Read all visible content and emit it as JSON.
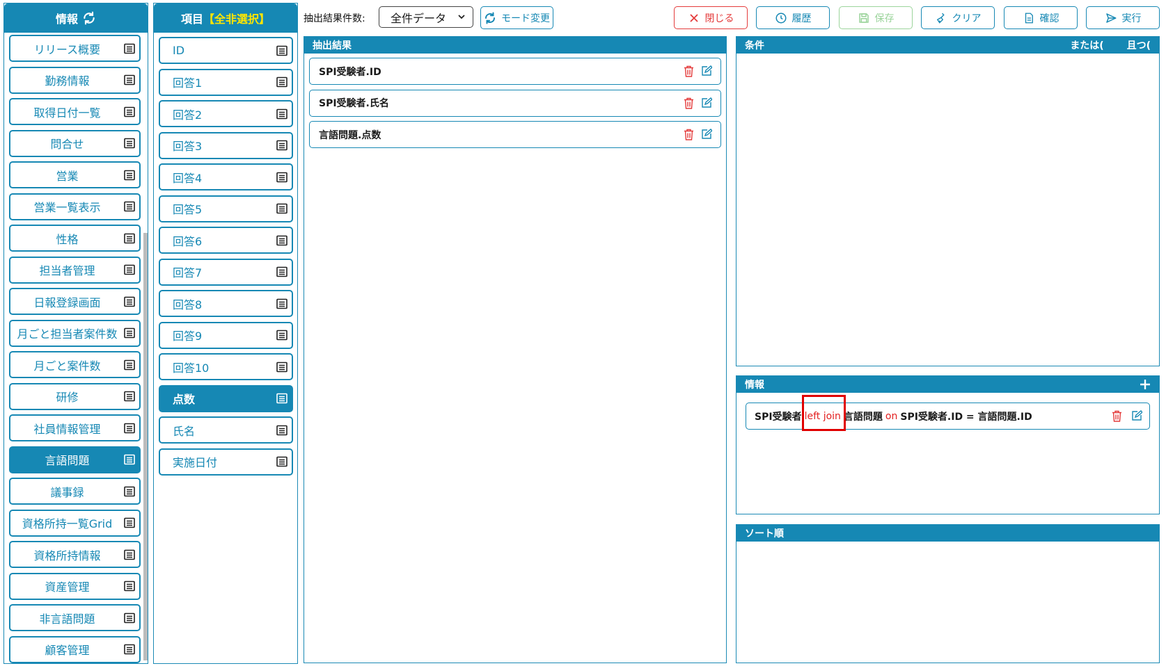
{
  "left": {
    "title": "情報",
    "items": [
      {
        "label": "リリース概要",
        "active": false
      },
      {
        "label": "勤務情報",
        "active": false
      },
      {
        "label": "取得日付一覧",
        "active": false
      },
      {
        "label": "問合せ",
        "active": false
      },
      {
        "label": "営業",
        "active": false
      },
      {
        "label": "営業一覧表示",
        "active": false
      },
      {
        "label": "性格",
        "active": false
      },
      {
        "label": "担当者管理",
        "active": false
      },
      {
        "label": "日報登録画面",
        "active": false
      },
      {
        "label": "月ごと担当者案件数",
        "active": false
      },
      {
        "label": "月ごと案件数",
        "active": false
      },
      {
        "label": "研修",
        "active": false
      },
      {
        "label": "社員情報管理",
        "active": false
      },
      {
        "label": "言語問題",
        "active": true
      },
      {
        "label": "議事録",
        "active": false
      },
      {
        "label": "資格所持一覧Grid",
        "active": false
      },
      {
        "label": "資格所持情報",
        "active": false
      },
      {
        "label": "資産管理",
        "active": false
      },
      {
        "label": "非言語問題",
        "active": false
      },
      {
        "label": "顧客管理",
        "active": false
      }
    ]
  },
  "fields": {
    "title_prefix": "項目",
    "title_select_all": "【全非選択】",
    "items": [
      {
        "label": "ID",
        "active": false
      },
      {
        "label": "回答1",
        "active": false
      },
      {
        "label": "回答2",
        "active": false
      },
      {
        "label": "回答3",
        "active": false
      },
      {
        "label": "回答4",
        "active": false
      },
      {
        "label": "回答5",
        "active": false
      },
      {
        "label": "回答6",
        "active": false
      },
      {
        "label": "回答7",
        "active": false
      },
      {
        "label": "回答8",
        "active": false
      },
      {
        "label": "回答9",
        "active": false
      },
      {
        "label": "回答10",
        "active": false
      },
      {
        "label": "点数",
        "active": true
      },
      {
        "label": "氏名",
        "active": false
      },
      {
        "label": "実施日付",
        "active": false
      }
    ]
  },
  "toolbar": {
    "count_label": "抽出結果件数:",
    "count_select_value": "全件データ",
    "mode_change": "モード変更",
    "close": "閉じる",
    "history": "履歴",
    "save": "保存",
    "clear": "クリア",
    "confirm": "確認",
    "run": "実行"
  },
  "result": {
    "title": "抽出結果",
    "items": [
      "SPI受験者.ID",
      "SPI受験者.氏名",
      "言語問題.点数"
    ]
  },
  "condition": {
    "title": "条件",
    "or_label": "または(",
    "and_label": "且つ("
  },
  "info": {
    "title": "情報",
    "join": {
      "left_table": "SPI受験者",
      "join_keyword": "left join",
      "right_table": "言語問題",
      "on_keyword": "on",
      "condition": "SPI受験者.ID = 言語問題.ID"
    }
  },
  "sort": {
    "title": "ソート順"
  },
  "colors": {
    "accent": "#1688b4",
    "danger": "#e43b3b",
    "save_disabled": "#9bd49b",
    "select_all": "#ffe600"
  }
}
